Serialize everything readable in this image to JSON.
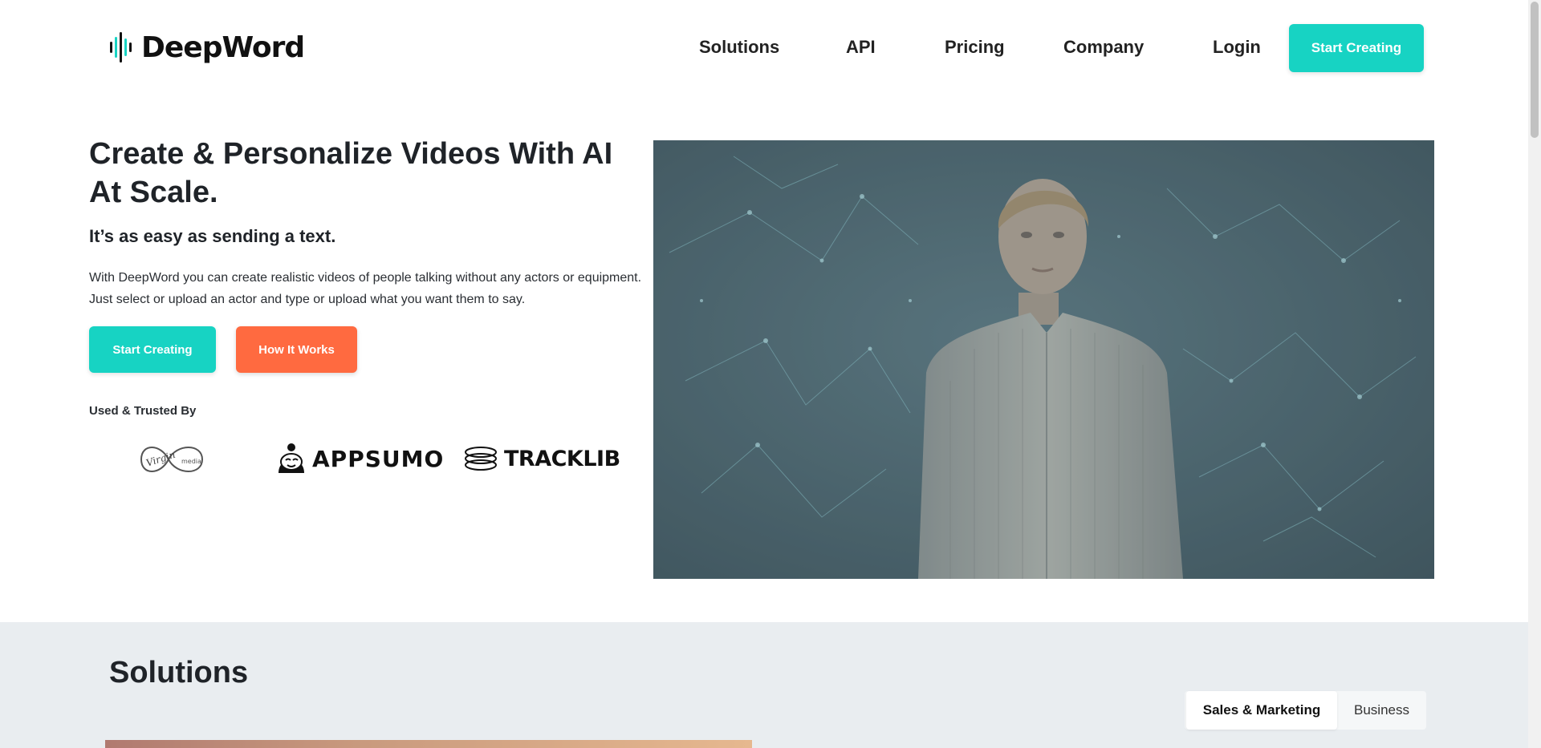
{
  "header": {
    "brand": "DeepWord",
    "nav": [
      {
        "label": "Solutions"
      },
      {
        "label": "API"
      },
      {
        "label": "Pricing"
      },
      {
        "label": "Company"
      },
      {
        "label": "Login"
      }
    ],
    "cta_label": "Start Creating"
  },
  "hero": {
    "title": "Create & Personalize Videos With AI At Scale.",
    "subtitle": "It’s as easy as sending a text.",
    "description": "With DeepWord you can create realistic videos of people talking without any actors or equipment. Just select or upload an actor and type or upload what you want them to say.",
    "primary_label": "Start Creating",
    "secondary_label": "How It Works",
    "trusted_label": "Used & Trusted By",
    "brands": {
      "virgin_script": "Virgin",
      "virgin_sub": "media",
      "appsumo": "APPSUMO",
      "tracklib": "TRACKLIB"
    }
  },
  "solutions": {
    "title": "Solutions",
    "tabs": [
      {
        "label": "Sales & Marketing",
        "active": true
      },
      {
        "label": "Business",
        "active": false
      }
    ]
  },
  "colors": {
    "accent": "#17d3c3",
    "secondary": "#ff6a40",
    "section_bg": "#e9edf0"
  }
}
